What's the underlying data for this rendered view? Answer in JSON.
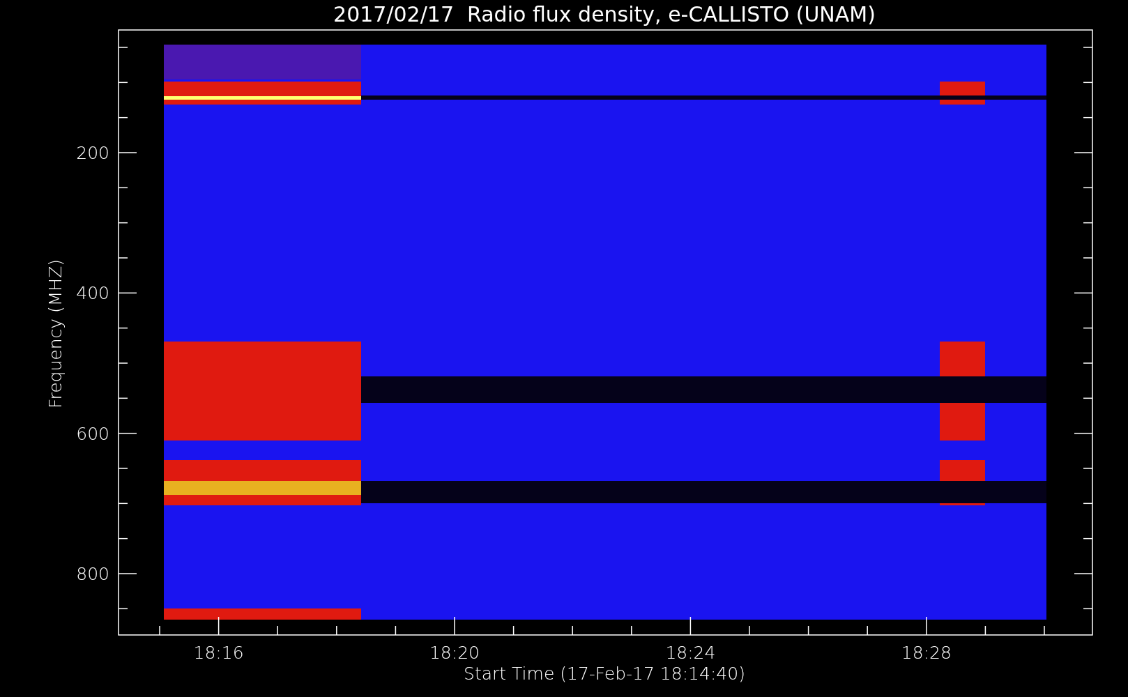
{
  "title": "2017/02/17  Radio flux density, e-CALLISTO (UNAM)",
  "y_axis": {
    "label": "Frequency (MHZ)",
    "ticks": [
      "200",
      "400",
      "600",
      "800"
    ]
  },
  "x_axis": {
    "label": "Start Time (17-Feb-17 18:14:40)",
    "ticks": [
      "18:16",
      "18:20",
      "18:24",
      "18:28"
    ]
  }
}
